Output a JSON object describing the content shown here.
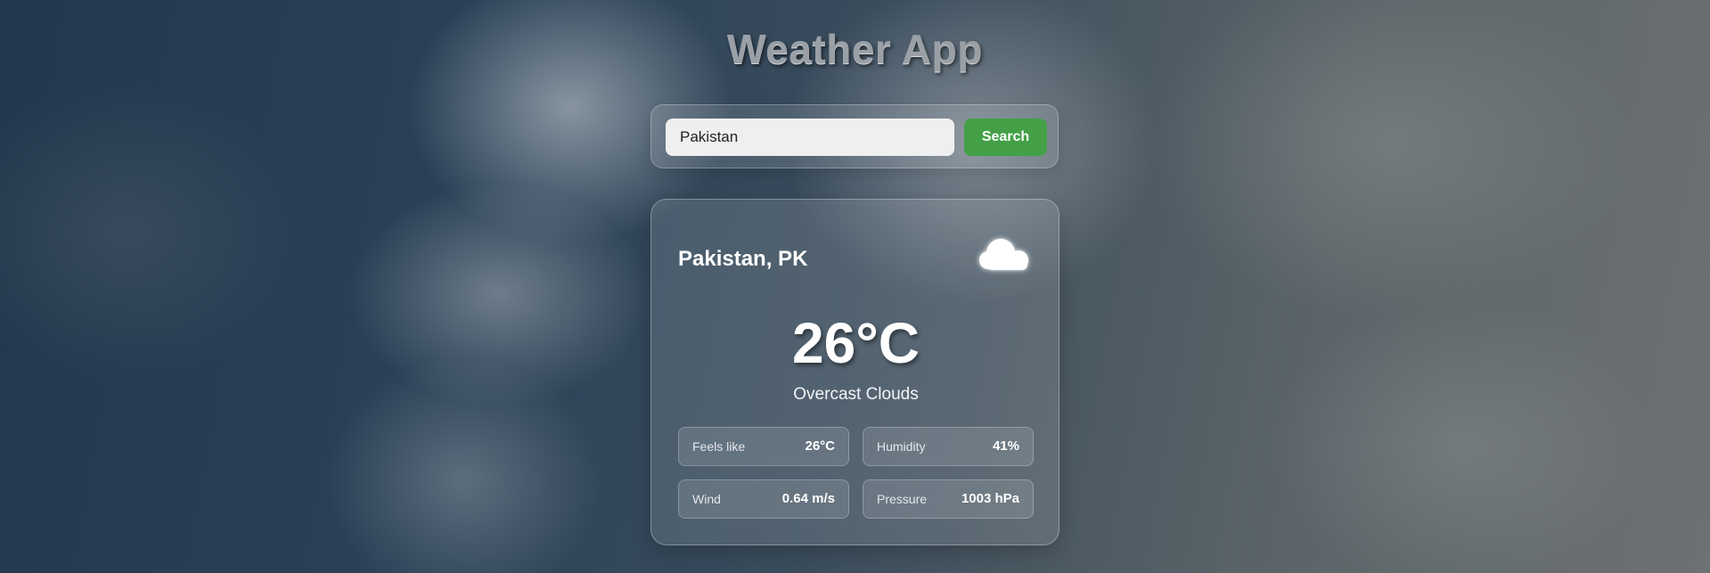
{
  "app": {
    "title": "Weather App"
  },
  "search": {
    "value": "Pakistan",
    "button_label": "Search"
  },
  "weather": {
    "location": "Pakistan, PK",
    "icon": "cloud-icon",
    "temperature": "26°C",
    "description": "Overcast Clouds",
    "details": [
      {
        "label": "Feels like",
        "value": "26°C"
      },
      {
        "label": "Humidity",
        "value": "41%"
      },
      {
        "label": "Wind",
        "value": "0.64 m/s"
      },
      {
        "label": "Pressure",
        "value": "1003 hPa"
      }
    ]
  },
  "colors": {
    "search_button": "#43a047",
    "text": "#ffffff"
  }
}
